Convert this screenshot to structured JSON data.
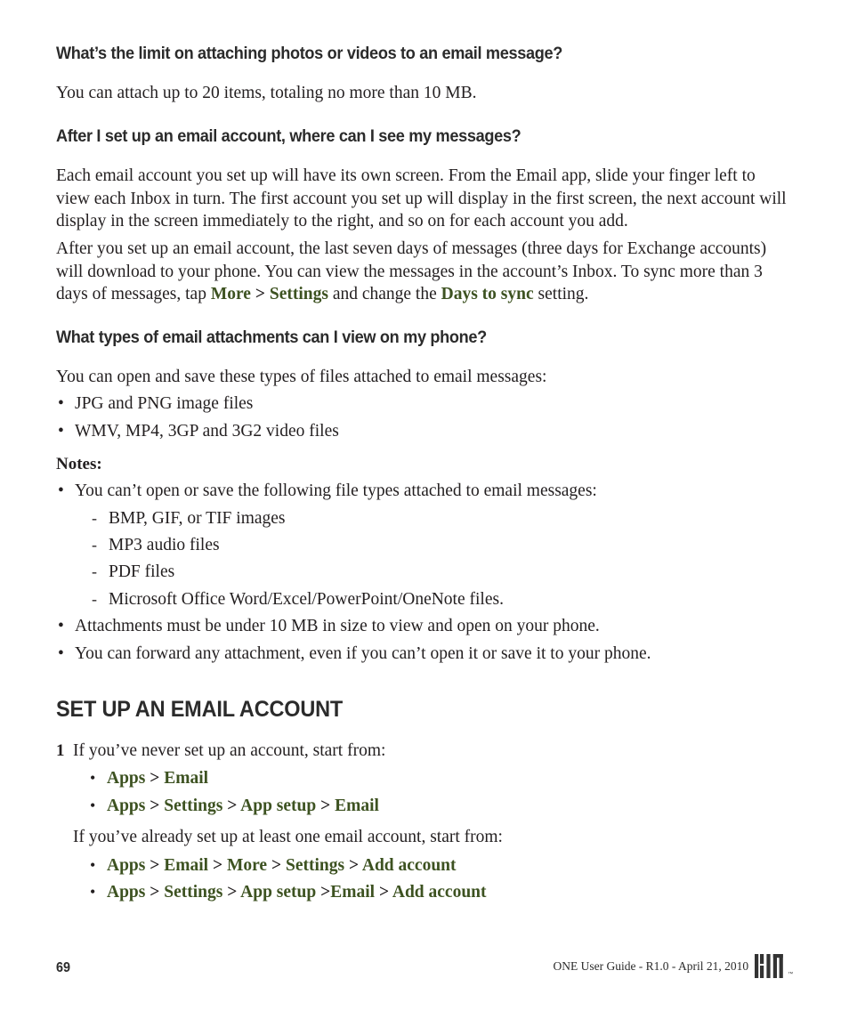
{
  "document": {
    "title": "ONE User Guide",
    "page_number": "69",
    "footer_text": "ONE User Guide - R1.0 - April 21, 2010",
    "logo_text": "KIN",
    "trademark": "™",
    "accent_color": "#3d5221",
    "text_color": "#231f20",
    "heading_color": "#2b2b2b"
  },
  "faq1": {
    "heading": "What’s the limit on attaching photos or videos to an email message?",
    "answer": "You can attach up to 20 items, totaling no more than 10 MB."
  },
  "faq2": {
    "heading": "After I set up an email account, where can I see my messages?",
    "para1": "Each email account you set up will have its own screen. From the Email app, slide your finger left to view each Inbox in turn. The first account you set up will display in the first screen, the next account will display in the screen immediately to the right, and so on for each account you add.",
    "para2_a": "After you set up an email account, the last seven days of messages (three days for Exchange accounts) will download to your phone. You can view the messages in the account’s Inbox. To sync more than 3 days of messages, tap ",
    "para2_ui1": "More",
    "para2_sep1": " > ",
    "para2_ui2": "Settings",
    "para2_b": " and change the ",
    "para2_ui3": "Days to sync",
    "para2_c": " setting."
  },
  "faq3": {
    "heading": "What types of email attachments can I view on my phone?",
    "intro": "You can open and save these types of files attached to email messages:",
    "bullets": [
      "JPG and PNG image files",
      "WMV, MP4, 3GP and 3G2 video files"
    ],
    "notes_label": "Notes:",
    "notes": [
      "You can’t open or save the following file types attached to email messages:",
      "Attachments must be under 10 MB in size to view and open on your phone.",
      "You can forward any attachment, even if you can’t open it or save it to your phone."
    ],
    "sub_bullets": [
      "BMP, GIF, or TIF images",
      "MP3 audio files",
      "PDF files",
      "Microsoft Office Word/Excel/PowerPoint/OneNote files."
    ],
    "bullet_marker": "•",
    "dash_marker": "-"
  },
  "section": {
    "heading": "SET UP AN EMAIL ACCOUNT",
    "step_number": "1",
    "step_text": "If you’ve never set up an account, start from:",
    "paths_never": [
      {
        "segments": [
          "Apps",
          "Email"
        ],
        "seps": [
          " > "
        ]
      },
      {
        "segments": [
          "Apps",
          "Settings",
          "App setup",
          "Email"
        ],
        "seps": [
          " > ",
          " > ",
          " > "
        ]
      }
    ],
    "already_text": "If you’ve already set up at least one email account, start from:",
    "paths_already": [
      {
        "segments": [
          "Apps",
          "Email",
          "More",
          "Settings",
          "Add account"
        ],
        "seps": [
          " > ",
          " > ",
          " > ",
          " > "
        ]
      },
      {
        "segments": [
          "Apps",
          "Settings",
          "App setup",
          "Email",
          "Add account"
        ],
        "seps": [
          " > ",
          " > ",
          " >",
          " > "
        ]
      }
    ]
  }
}
